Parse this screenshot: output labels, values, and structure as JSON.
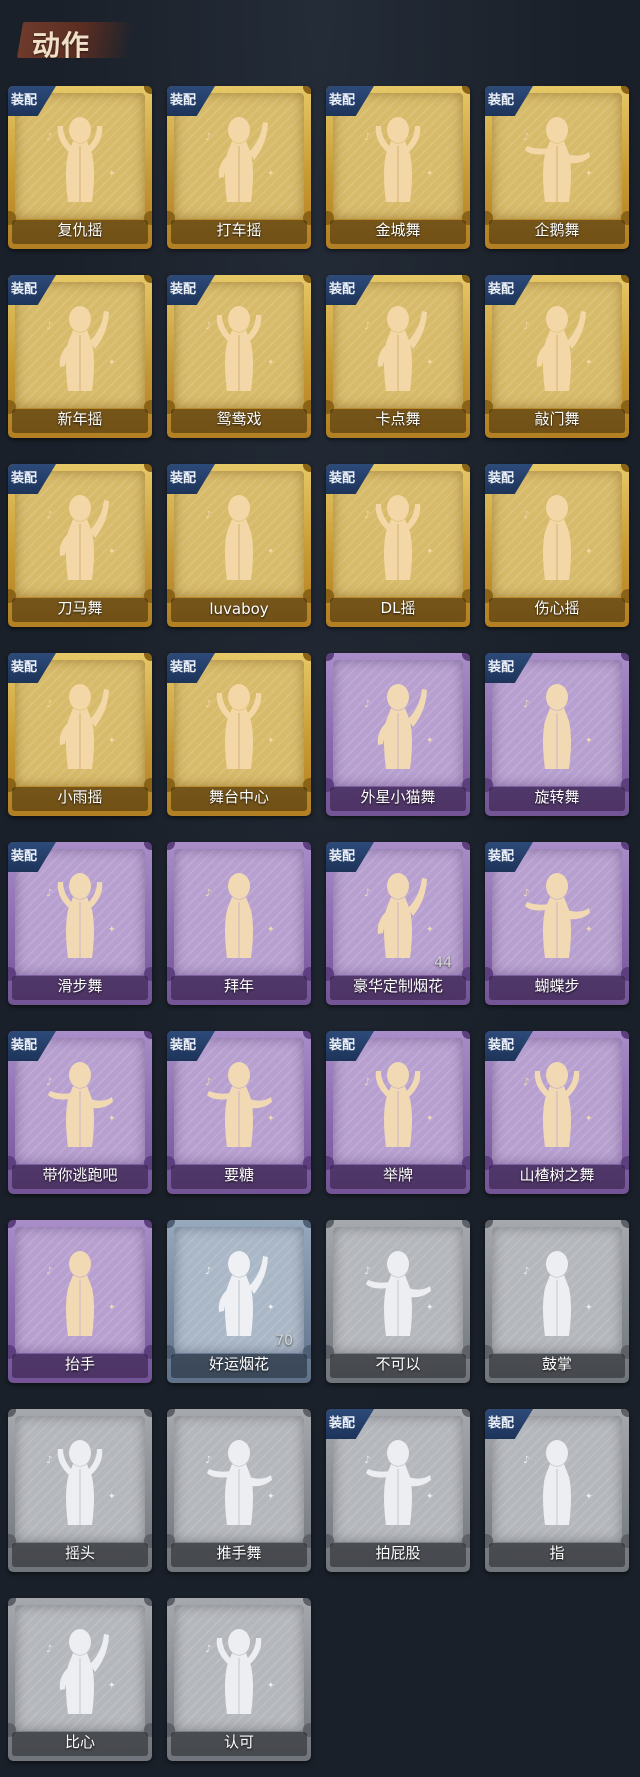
{
  "header": {
    "title": "动作"
  },
  "badge_label": "装配",
  "colors": {
    "gold": "#d7bb6a",
    "purple": "#9d83bf",
    "blue": "#8a9bb0",
    "gray": "#9a9da3",
    "badge": "#22406b",
    "background": "#1a2029"
  },
  "emotes": [
    {
      "name": "复仇摇",
      "rarity": "gold",
      "equipped": true,
      "icon": "dancer-hand-up-icon"
    },
    {
      "name": "打车摇",
      "rarity": "gold",
      "equipped": true,
      "icon": "dancer-fist-icon"
    },
    {
      "name": "金城舞",
      "rarity": "gold",
      "equipped": true,
      "icon": "dancer-wave-icon"
    },
    {
      "name": "企鹅舞",
      "rarity": "gold",
      "equipped": true,
      "icon": "dancer-arms-icon"
    },
    {
      "name": "新年摇",
      "rarity": "gold",
      "equipped": true,
      "icon": "dancer-cross-arms-icon"
    },
    {
      "name": "鸳鸯戏",
      "rarity": "gold",
      "equipped": true,
      "icon": "dancer-flex-icon"
    },
    {
      "name": "卡点舞",
      "rarity": "gold",
      "equipped": true,
      "icon": "dancer-point-up-icon"
    },
    {
      "name": "敲门舞",
      "rarity": "gold",
      "equipped": true,
      "icon": "dancer-knock-icon"
    },
    {
      "name": "刀马舞",
      "rarity": "gold",
      "equipped": true,
      "icon": "dancer-blade-icon"
    },
    {
      "name": "luvaboy",
      "rarity": "gold",
      "equipped": true,
      "icon": "dancer-hug-icon"
    },
    {
      "name": "DL摇",
      "rarity": "gold",
      "equipped": true,
      "icon": "dancer-arms-up-icon"
    },
    {
      "name": "伤心摇",
      "rarity": "gold",
      "equipped": true,
      "icon": "dancer-heart-icon"
    },
    {
      "name": "小雨摇",
      "rarity": "gold",
      "equipped": true,
      "icon": "dancer-rain-icon"
    },
    {
      "name": "舞台中心",
      "rarity": "gold",
      "equipped": true,
      "icon": "dancer-center-icon"
    },
    {
      "name": "外星小猫舞",
      "rarity": "purple",
      "equipped": false,
      "icon": "dancer-alien-cat-icon"
    },
    {
      "name": "旋转舞",
      "rarity": "purple",
      "equipped": true,
      "icon": "dancer-spin-icon"
    },
    {
      "name": "滑步舞",
      "rarity": "purple",
      "equipped": true,
      "icon": "dancer-slide-icon"
    },
    {
      "name": "拜年",
      "rarity": "purple",
      "equipped": false,
      "icon": "bow-greeting-icon"
    },
    {
      "name": "豪华定制烟花",
      "rarity": "purple",
      "equipped": true,
      "icon": "fireworks-box-icon",
      "count": "44"
    },
    {
      "name": "蝴蝶步",
      "rarity": "purple",
      "equipped": true,
      "icon": "dancer-butterfly-icon"
    },
    {
      "name": "带你逃跑吧",
      "rarity": "purple",
      "equipped": true,
      "icon": "dancer-run-icon"
    },
    {
      "name": "要糖",
      "rarity": "purple",
      "equipped": true,
      "icon": "ask-candy-icon"
    },
    {
      "name": "举牌",
      "rarity": "purple",
      "equipped": true,
      "icon": "hold-sign-icon"
    },
    {
      "name": "山楂树之舞",
      "rarity": "purple",
      "equipped": true,
      "icon": "dancer-hawthorn-icon"
    },
    {
      "name": "抬手",
      "rarity": "purple",
      "equipped": false,
      "icon": "raise-hand-icon"
    },
    {
      "name": "好运烟花",
      "rarity": "blue",
      "equipped": false,
      "icon": "firework-tube-icon",
      "count": "70"
    },
    {
      "name": "不可以",
      "rarity": "gray",
      "equipped": false,
      "icon": "finger-no-icon"
    },
    {
      "name": "鼓掌",
      "rarity": "gray",
      "equipped": false,
      "icon": "clap-icon"
    },
    {
      "name": "摇头",
      "rarity": "gray",
      "equipped": false,
      "icon": "shake-head-icon"
    },
    {
      "name": "推手舞",
      "rarity": "gray",
      "equipped": false,
      "icon": "push-hands-icon"
    },
    {
      "name": "拍屁股",
      "rarity": "gray",
      "equipped": true,
      "icon": "pat-butt-icon"
    },
    {
      "name": "指",
      "rarity": "gray",
      "equipped": true,
      "icon": "point-icon"
    },
    {
      "name": "比心",
      "rarity": "gray",
      "equipped": false,
      "icon": "finger-heart-icon"
    },
    {
      "name": "认可",
      "rarity": "gray",
      "equipped": false,
      "icon": "thumbs-up-icon"
    }
  ]
}
